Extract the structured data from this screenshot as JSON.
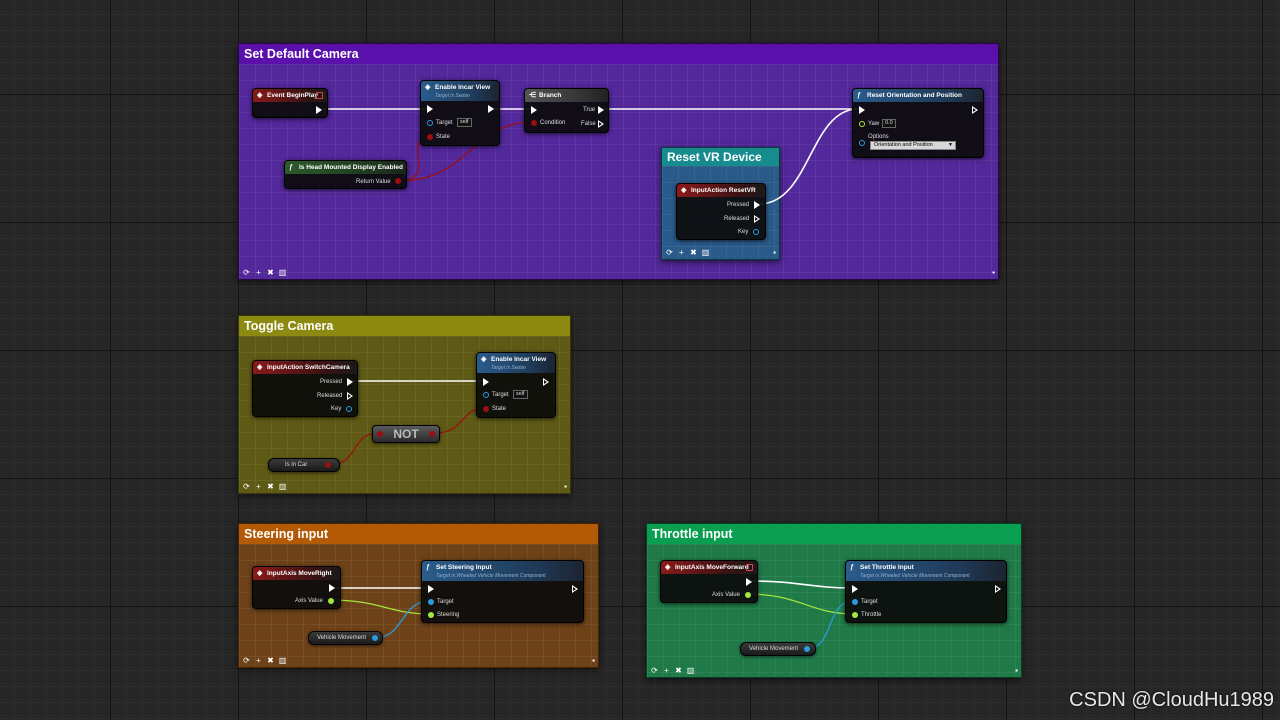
{
  "colors": {
    "comment_set_default": "#5b0fa8",
    "comment_reset_vr": "#1b8a8c",
    "comment_toggle": "#8a8a12",
    "comment_steering": "#b05a08",
    "comment_throttle": "#0aa050",
    "exec": "#ffffff",
    "object_pin": "#2a9bdc",
    "bool_pin": "#9a0f0f",
    "float_pin": "#a5e640"
  },
  "comments": {
    "set_default_camera": "Set Default Camera",
    "reset_vr_device": "Reset VR Device",
    "toggle_camera": "Toggle Camera",
    "steering_input": "Steering input",
    "throttle_input": "Throttle input"
  },
  "nodes": {
    "event_begin_play": {
      "title": "Event BeginPlay"
    },
    "enable_incar_view_1": {
      "title": "Enable Incar View",
      "subtitle": "Target is Sedan",
      "target_label": "Target",
      "target_value": "self",
      "state_label": "State"
    },
    "branch": {
      "title": "Branch",
      "true_label": "True",
      "false_label": "False",
      "condition_label": "Condition"
    },
    "is_hmd_enabled": {
      "title": "Is Head Mounted Display Enabled",
      "return_label": "Return Value"
    },
    "reset_orientation": {
      "title": "Reset Orientation and Position",
      "yaw_label": "Yaw",
      "yaw_value": "0.0",
      "options_label": "Options",
      "options_value": "Orientation and Position"
    },
    "input_reset_vr": {
      "title": "InputAction ResetVR",
      "pressed": "Pressed",
      "released": "Released",
      "key": "Key"
    },
    "input_switch_camera": {
      "title": "InputAction SwitchCamera",
      "pressed": "Pressed",
      "released": "Released",
      "key": "Key"
    },
    "enable_incar_view_2": {
      "title": "Enable Incar View",
      "subtitle": "Target is Sedan",
      "target_label": "Target",
      "target_value": "self",
      "state_label": "State"
    },
    "not_node": {
      "label": "NOT"
    },
    "is_in_car": {
      "label": "Is in Car"
    },
    "input_move_right": {
      "title": "InputAxis MoveRight",
      "axis_label": "Axis Value"
    },
    "set_steering_input": {
      "title": "Set Steering Input",
      "subtitle": "Target is Wheeled Vehicle Movement Component",
      "target_label": "Target",
      "param_label": "Steering"
    },
    "vehicle_movement_1": {
      "label": "Vehicle Movement"
    },
    "input_move_forward": {
      "title": "InputAxis MoveForward",
      "axis_label": "Axis Value"
    },
    "set_throttle_input": {
      "title": "Set Throttle Input",
      "subtitle": "Target is Wheeled Vehicle Movement Component",
      "target_label": "Target",
      "param_label": "Throttle"
    },
    "vehicle_movement_2": {
      "label": "Vehicle Movement"
    }
  },
  "comment_tools": [
    "refresh-icon",
    "add-icon",
    "close-icon",
    "delete-icon"
  ],
  "watermark": "CSDN @CloudHu1989"
}
